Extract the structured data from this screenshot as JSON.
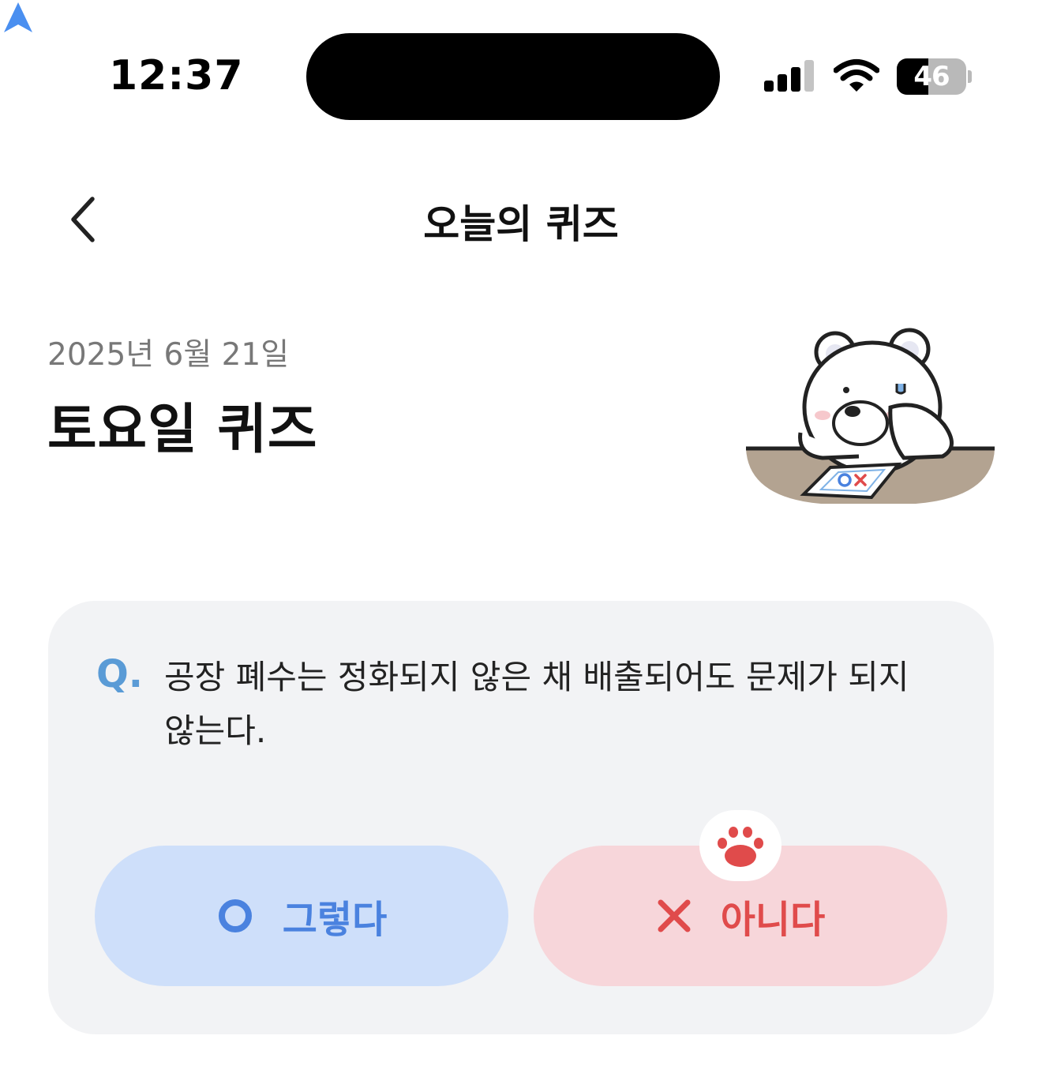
{
  "status_bar": {
    "time": "12:37",
    "battery_level": "46",
    "battery_fraction": 0.46,
    "icons": [
      "navigation-arrow-icon",
      "cellular-signal-icon",
      "wifi-icon",
      "battery-icon"
    ]
  },
  "header": {
    "title": "오늘의 퀴즈",
    "back_icon": "chevron-left-icon"
  },
  "intro": {
    "date": "2025년 6월 21일",
    "title": "토요일 퀴즈"
  },
  "quiz": {
    "q_prefix": "Q.",
    "question": "공장 폐수는 정화되지 않은 채 배출되어도 문제가 되지 않는다.",
    "answers": [
      {
        "label": "그렇다",
        "icon": "circle-o-icon"
      },
      {
        "label": "아니다",
        "icon": "x-cross-icon"
      }
    ],
    "selected_marker_icon": "paw-print-icon"
  },
  "colors": {
    "accent_blue": "#4a82df",
    "accent_red": "#e04b4b",
    "yes_bg": "#cedffa",
    "no_bg": "#f7d6da",
    "card_bg": "#f2f3f5",
    "q_mark": "#5a9bd6"
  }
}
